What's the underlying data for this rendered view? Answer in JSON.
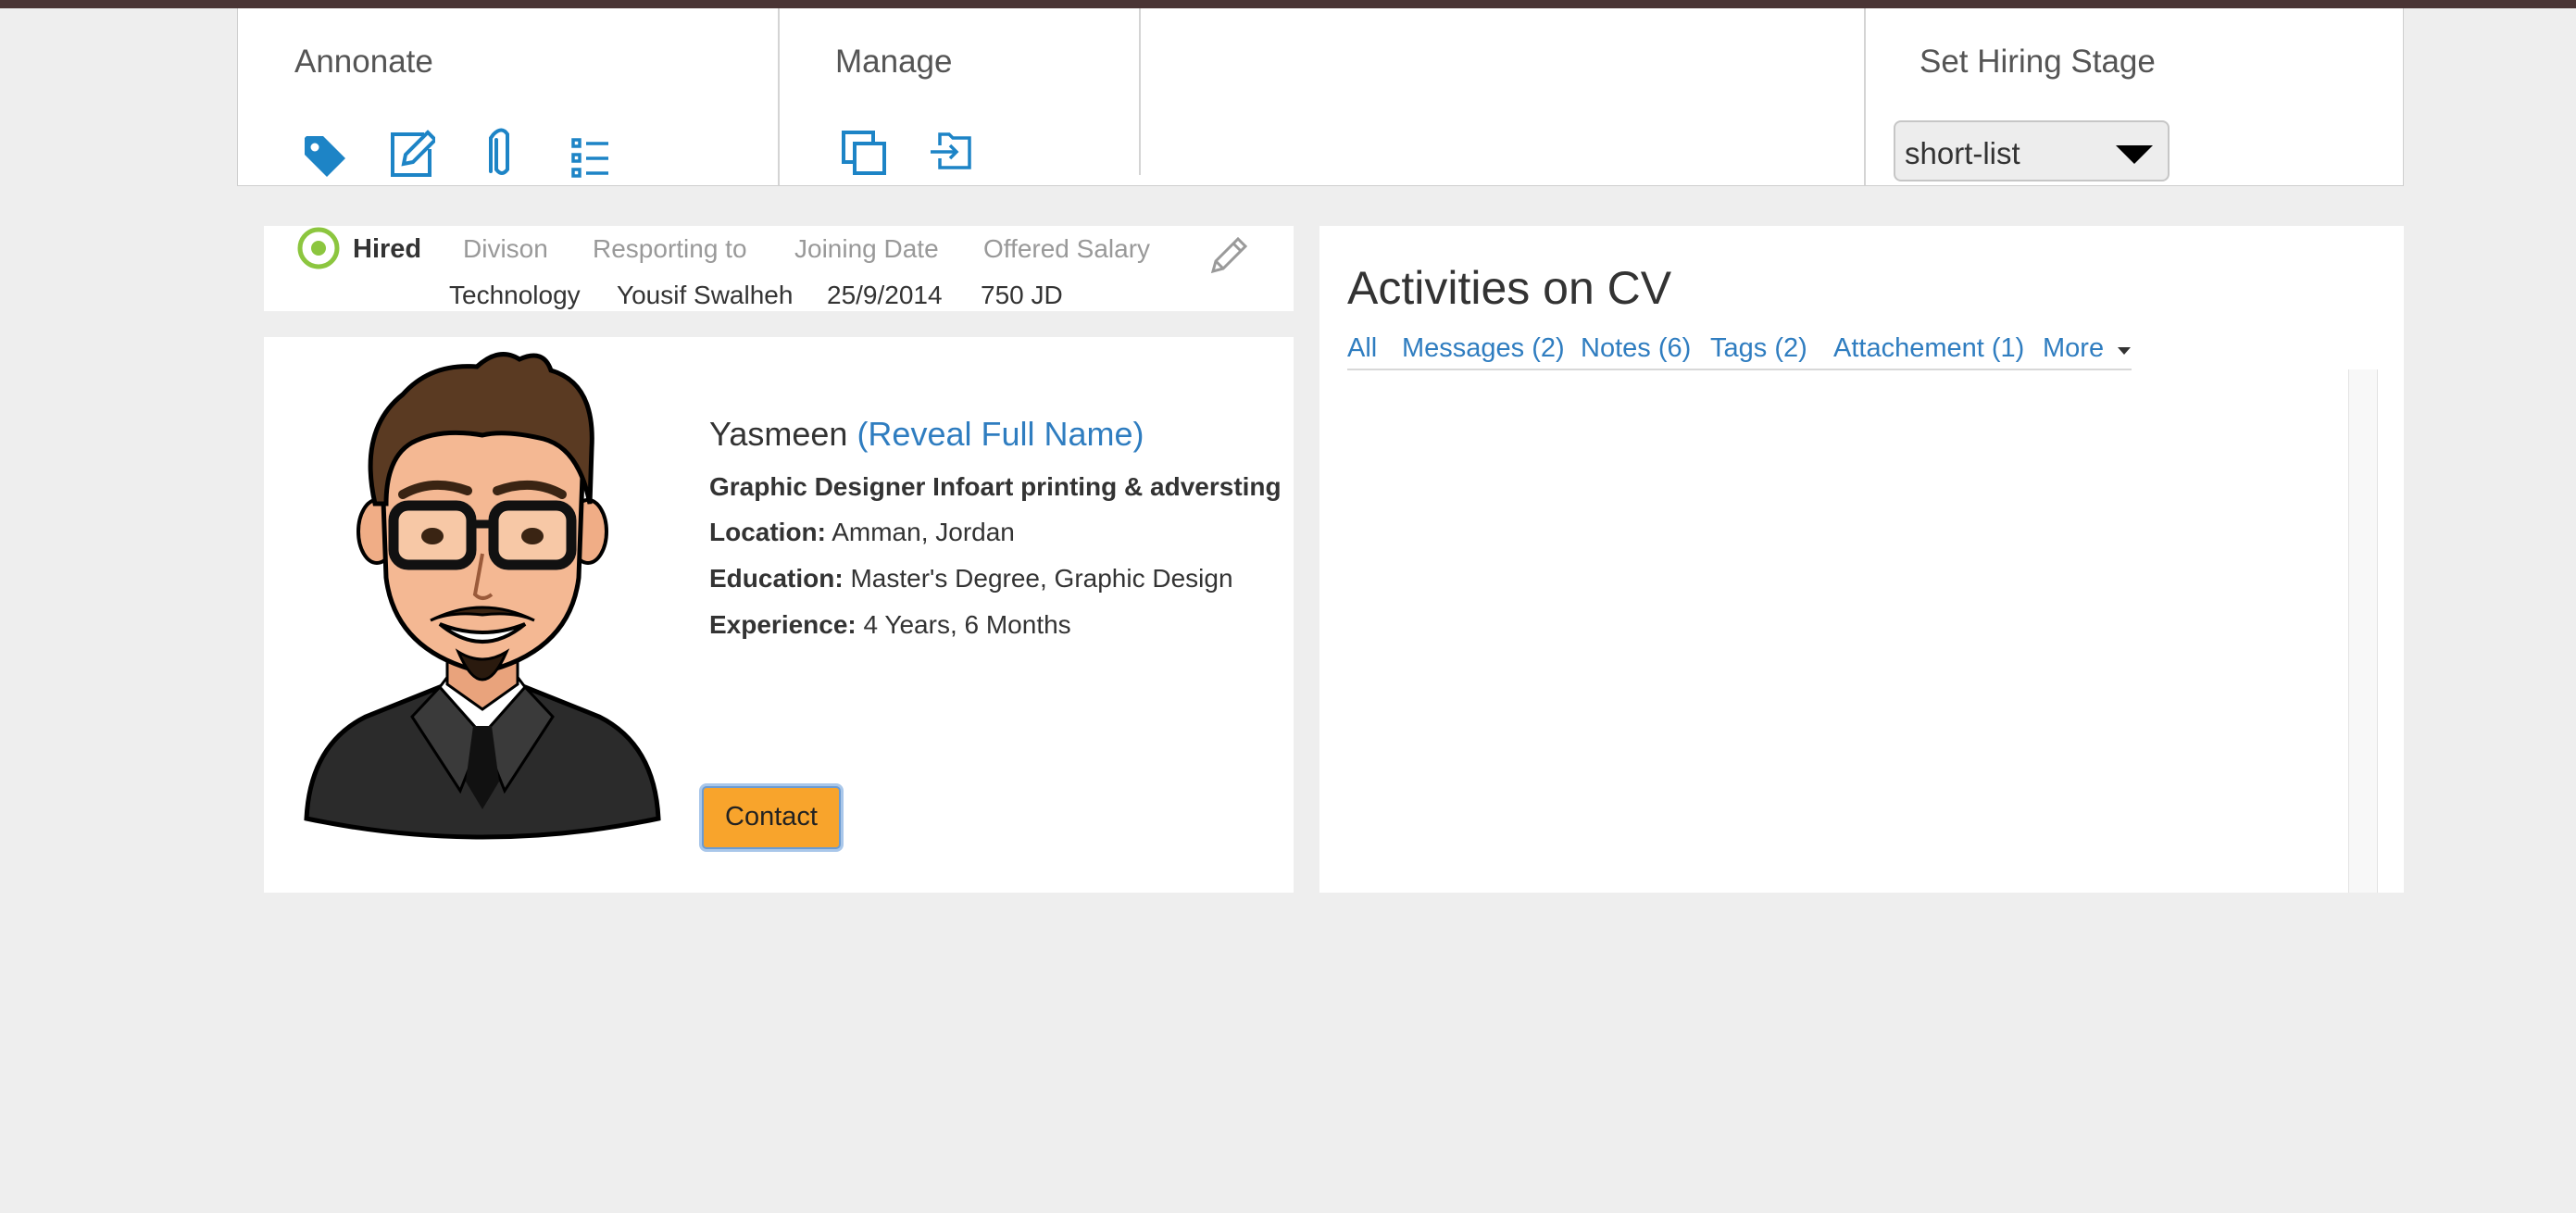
{
  "toolbar": {
    "annotate": {
      "title": "Annonate",
      "icons": [
        "tag-icon",
        "edit-note-icon",
        "paperclip-icon",
        "checklist-icon"
      ]
    },
    "manage": {
      "title": "Manage",
      "icons": [
        "copy-icon",
        "move-to-folder-icon"
      ]
    },
    "hiring_stage": {
      "title": "Set Hiring Stage",
      "selected": "short-list"
    }
  },
  "status": {
    "label": "Hired",
    "headers": [
      "Divison",
      "Resporting to",
      "Joining Date",
      "Offered Salary"
    ],
    "values": [
      "Technology",
      "Yousif Swalheh",
      "25/9/2014",
      "750 JD"
    ]
  },
  "profile": {
    "name": "Yasmeen",
    "reveal_link": "(Reveal Full Name)",
    "title": "Graphic Designer Infoart printing & adversting",
    "location_label": "Location:",
    "location": "Amman, Jordan",
    "education_label": "Education:",
    "education": "Master's Degree, Graphic Design",
    "experience_label": "Experience:",
    "experience": "4 Years, 6 Months",
    "contact_button": "Contact"
  },
  "activities": {
    "title": "Activities on CV",
    "tabs": [
      "All",
      "Messages (2)",
      "Notes (6)",
      "Tags (2)",
      "Attachement (1)",
      "More"
    ]
  },
  "colors": {
    "link_blue": "#2f7dc0",
    "icon_blue": "#1d84c6",
    "hired_green": "#8cc63f",
    "contact_orange": "#f8a42c",
    "top_strip": "#4a3535"
  }
}
